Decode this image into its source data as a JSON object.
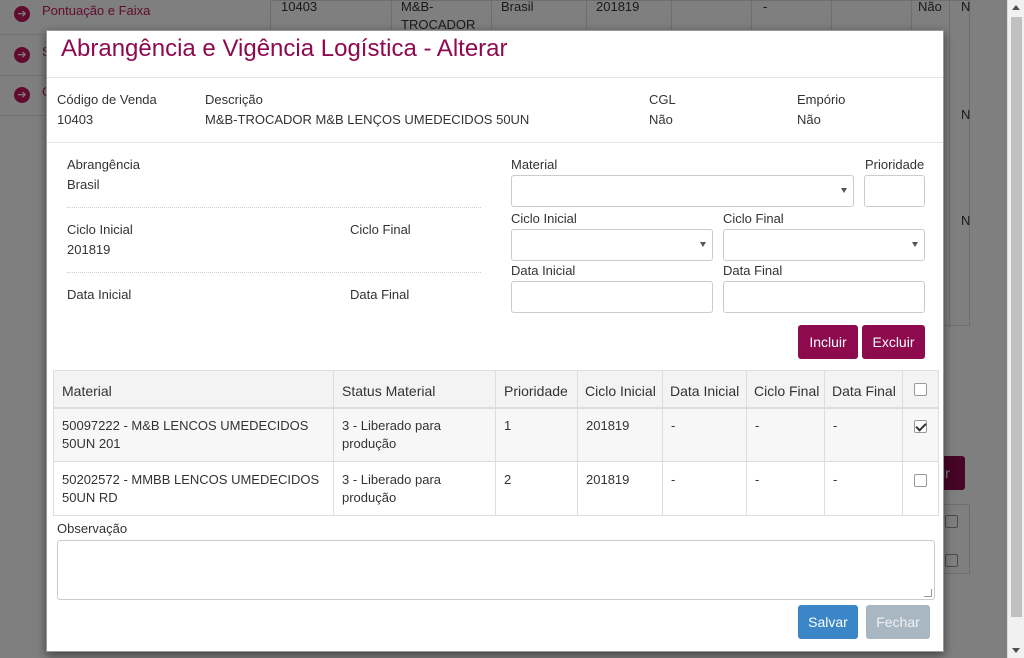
{
  "background": {
    "sidebar_items": [
      {
        "label": "Pontuação e Faixa"
      },
      {
        "label": "S"
      },
      {
        "label": "C"
      }
    ],
    "table_row": {
      "codigo": "10403",
      "descricao_1": "M&B-",
      "descricao_2": "TROCADOR",
      "abrangencia": "Brasil",
      "ciclo": "201819",
      "dash": "-",
      "nao": "Não",
      "n": "N"
    },
    "n_marks": [
      "N",
      "N"
    ],
    "button_fragment": "ir"
  },
  "modal": {
    "title": "Abrangência e Vigência Logística - Alterar",
    "info": {
      "codigo_label": "Código de Venda",
      "codigo_value": "10403",
      "descricao_label": "Descrição",
      "descricao_value": "M&B-TROCADOR M&B LENÇOS UMEDECIDOS 50UN",
      "cgl_label": "CGL",
      "cgl_value": "Não",
      "emporio_label": "Empório",
      "emporio_value": "Não"
    },
    "left_summary": {
      "abrangencia_label": "Abrangência",
      "abrangencia_value": "Brasil",
      "ciclo_inicial_label": "Ciclo Inicial",
      "ciclo_inicial_value": "201819",
      "ciclo_final_label": "Ciclo Final",
      "data_inicial_label": "Data Inicial",
      "data_final_label": "Data Final"
    },
    "form": {
      "material_label": "Material",
      "prioridade_label": "Prioridade",
      "ciclo_inicial_label": "Ciclo Inicial",
      "ciclo_final_label": "Ciclo Final",
      "data_inicial_label": "Data Inicial",
      "data_final_label": "Data Final",
      "incluir_button": "Incluir",
      "excluir_button": "Excluir"
    },
    "table": {
      "headers": [
        "Material",
        "Status Material",
        "Prioridade",
        "Ciclo Inicial",
        "Data Inicial",
        "Ciclo Final",
        "Data Final"
      ],
      "rows": [
        {
          "material_1": "50097222 - M&B LENCOS UMEDECIDOS",
          "material_2": "50UN 201",
          "status_1": "3 - Liberado para",
          "status_2": "produção",
          "prioridade": "1",
          "ciclo_inicial": "201819",
          "data_inicial": "-",
          "ciclo_final": "-",
          "data_final": "-",
          "checked": true
        },
        {
          "material_1": "50202572 - MMBB LENCOS UMEDECIDOS",
          "material_2": "50UN RD",
          "status_1": "3 - Liberado para",
          "status_2": "produção",
          "prioridade": "2",
          "ciclo_inicial": "201819",
          "data_inicial": "-",
          "ciclo_final": "-",
          "data_final": "-",
          "checked": false
        }
      ]
    },
    "observacao_label": "Observação",
    "salvar_button": "Salvar",
    "fechar_button": "Fechar"
  },
  "colors": {
    "brand": "#8e0a4e",
    "primary_blue": "#3a86c6",
    "disabled_gray": "#a9b7c3"
  }
}
